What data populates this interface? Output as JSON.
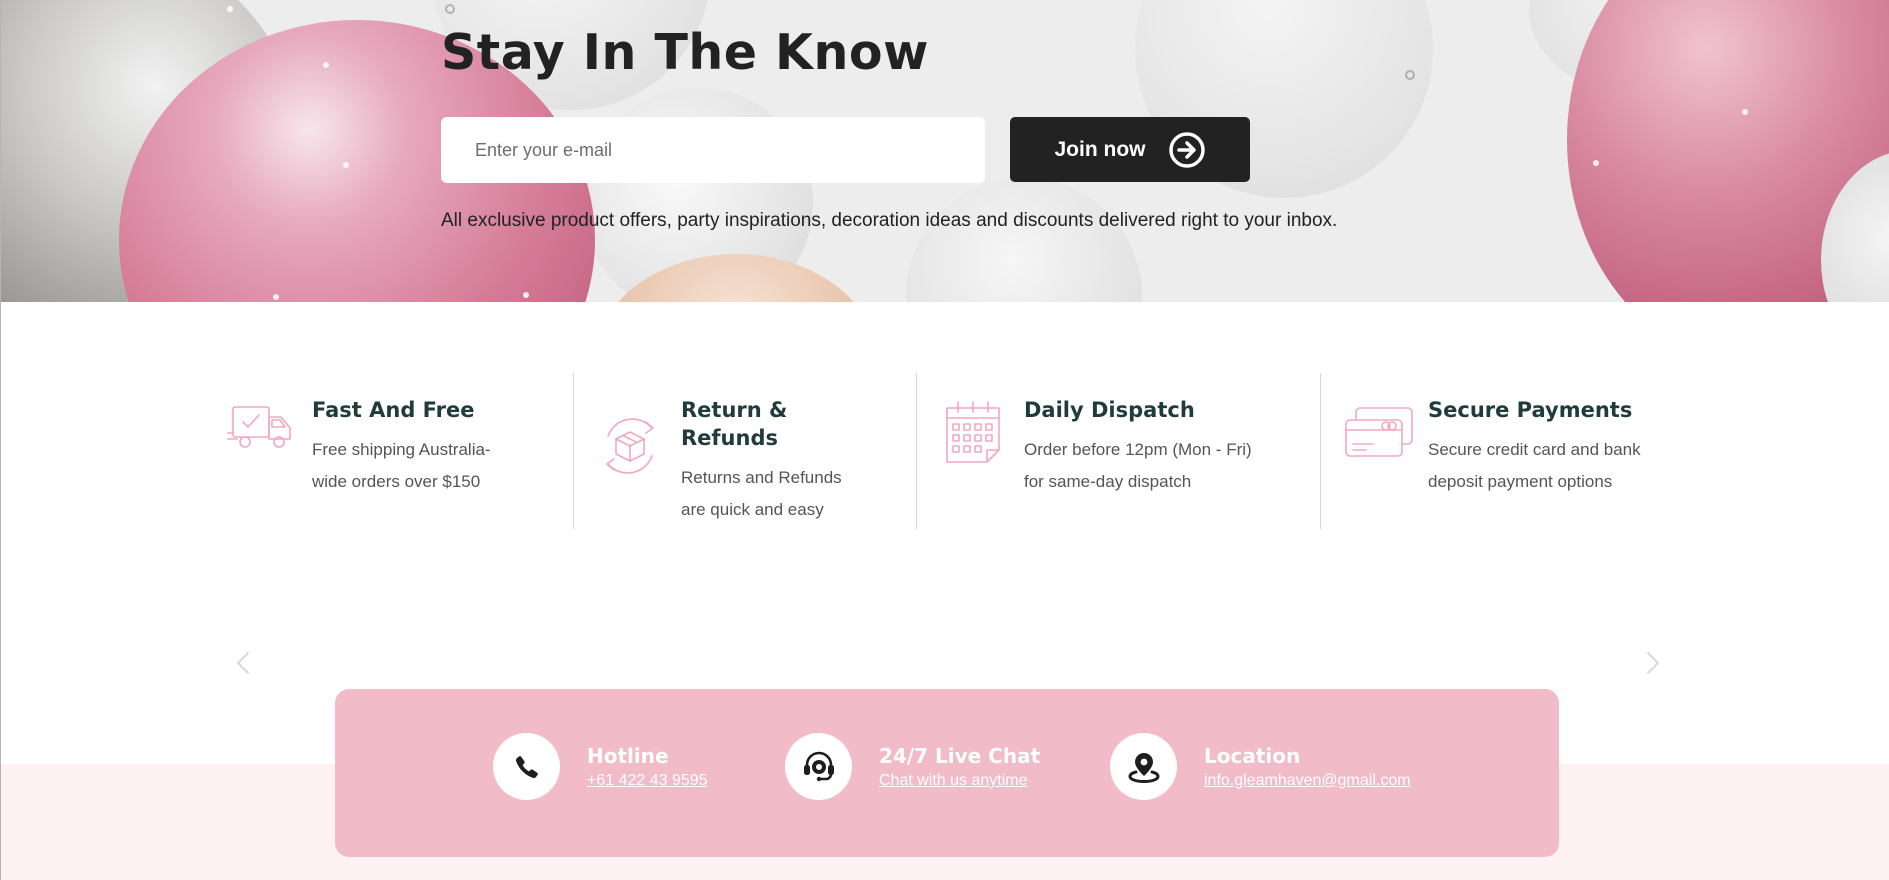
{
  "newsletter": {
    "title": "Stay In The Know",
    "email_placeholder": "Enter your e-mail",
    "join_label": "Join now",
    "subtitle": "All exclusive product offers, party inspirations, decoration ideas and discounts delivered right to your inbox."
  },
  "features": [
    {
      "icon": "delivery-truck-icon",
      "title": "Fast And Free",
      "desc_line1": "Free shipping Australia-",
      "desc_line2": "wide orders over $150"
    },
    {
      "icon": "box-return-icon",
      "title_line1": "Return &",
      "title_line2": "Refunds",
      "desc_line1": "Returns and Refunds",
      "desc_line2": "are quick and easy"
    },
    {
      "icon": "calendar-icon",
      "title": "Daily Dispatch",
      "desc_line1": "Order before 12pm (Mon - Fri)",
      "desc_line2": "for same-day dispatch"
    },
    {
      "icon": "credit-card-icon",
      "title": "Secure Payments",
      "desc_line1": "Secure credit card and bank",
      "desc_line2": "deposit payment options"
    }
  ],
  "slider": {
    "prev_icon": "chevron-left-icon",
    "next_icon": "chevron-right-icon"
  },
  "contact": [
    {
      "icon": "phone-icon",
      "title": "Hotline",
      "link": "+61 422 43 9595"
    },
    {
      "icon": "headset-chat-icon",
      "title": "24/7 Live Chat",
      "link": "Chat with us anytime"
    },
    {
      "icon": "location-pin-icon",
      "title": "Location",
      "link": "info.gleamhaven@gmail.com"
    }
  ],
  "colors": {
    "accent_pink": "#f1bcc8",
    "icon_pink": "#f0a8bd",
    "dark_button": "#222222",
    "heading_green": "#1f3b3b",
    "footer_band": "#fdf1f4"
  }
}
